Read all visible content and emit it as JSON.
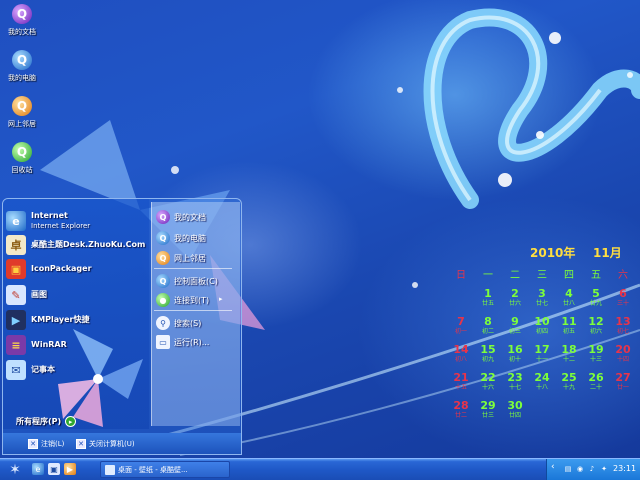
{
  "desktop": {
    "icons": [
      {
        "label": "我的文档",
        "glyph": "Q",
        "color": "#7a2fd0"
      },
      {
        "label": "我的电脑",
        "glyph": "Q",
        "color": "#1c68c8"
      },
      {
        "label": "网上邻居",
        "glyph": "Q",
        "color": "#e07a10"
      },
      {
        "label": "回收站",
        "glyph": "Q",
        "color": "#22a32a"
      }
    ]
  },
  "start_menu": {
    "pinned": [
      {
        "title": "Internet",
        "subtitle": "Internet Explorer",
        "icon": "internet-explorer-icon",
        "glyph": "e"
      },
      {
        "title": "桌酷主题Desk.ZhuoKu.Com",
        "icon": "theme-icon",
        "glyph": "卓"
      },
      {
        "title": "IconPackager",
        "icon": "iconpackager-icon",
        "glyph": "▣"
      },
      {
        "title": "画图",
        "icon": "paint-icon",
        "glyph": "✎"
      },
      {
        "title": "KMPlayer快捷",
        "icon": "kmplayer-icon",
        "glyph": "▶"
      },
      {
        "title": "WinRAR",
        "icon": "winrar-icon",
        "glyph": "≡"
      },
      {
        "title": "记事本",
        "icon": "notepad-icon",
        "glyph": "✉"
      }
    ],
    "all_programs": "所有程序(P)",
    "all_programs_arrow": "▸",
    "right_items": [
      {
        "label": "我的文档",
        "icon": "my-documents-icon",
        "glyph": "Q"
      },
      {
        "label": "我的电脑",
        "icon": "my-computer-icon",
        "glyph": "Q"
      },
      {
        "label": "网上邻居",
        "icon": "network-icon",
        "glyph": "Q"
      },
      {
        "label": "控制面板(C)",
        "icon": "control-panel-icon",
        "glyph": "Q"
      },
      {
        "label": "连接到(T)",
        "icon": "connect-icon",
        "glyph": "●",
        "arrow": "▸"
      },
      {
        "label": "搜索(S)",
        "icon": "search-icon",
        "glyph": "⚲"
      },
      {
        "label": "运行(R)...",
        "icon": "run-icon",
        "glyph": "▭"
      }
    ],
    "logoff": "注销(L)",
    "logoff_glyph": "✕",
    "shutdown": "关闭计算机(U)",
    "shutdown_glyph": "✕"
  },
  "calendar": {
    "year": "2010年",
    "month": "11月",
    "weekdays": [
      "日",
      "一",
      "二",
      "三",
      "四",
      "五",
      "六"
    ],
    "days": [
      {
        "d": "1",
        "l": "廿五"
      },
      {
        "d": "2",
        "l": "廿六"
      },
      {
        "d": "3",
        "l": "廿七"
      },
      {
        "d": "4",
        "l": "廿八"
      },
      {
        "d": "5",
        "l": "廿九"
      },
      {
        "d": "6",
        "l": "三十"
      },
      {
        "d": "7",
        "l": "初一"
      },
      {
        "d": "8",
        "l": "初二"
      },
      {
        "d": "9",
        "l": "初三"
      },
      {
        "d": "10",
        "l": "初四"
      },
      {
        "d": "11",
        "l": "初五"
      },
      {
        "d": "12",
        "l": "初六"
      },
      {
        "d": "13",
        "l": "初七"
      },
      {
        "d": "14",
        "l": "初八"
      },
      {
        "d": "15",
        "l": "初九"
      },
      {
        "d": "16",
        "l": "初十"
      },
      {
        "d": "17",
        "l": "十一"
      },
      {
        "d": "18",
        "l": "十二"
      },
      {
        "d": "19",
        "l": "十三"
      },
      {
        "d": "20",
        "l": "十四"
      },
      {
        "d": "21",
        "l": "十五"
      },
      {
        "d": "22",
        "l": "十六"
      },
      {
        "d": "23",
        "l": "十七"
      },
      {
        "d": "24",
        "l": "十八"
      },
      {
        "d": "25",
        "l": "十九"
      },
      {
        "d": "26",
        "l": "二十"
      },
      {
        "d": "27",
        "l": "廿一"
      },
      {
        "d": "28",
        "l": "廿二"
      },
      {
        "d": "29",
        "l": "廿三"
      },
      {
        "d": "30",
        "l": "廿四"
      }
    ],
    "first_weekday": 1,
    "weekend_color": "#e8344a",
    "weekday_color": "#7dff3a"
  },
  "taskbar": {
    "start_icon": "✶",
    "quick_launch": [
      {
        "icon": "ie-quicklaunch-icon",
        "glyph": "e"
      },
      {
        "icon": "show-desktop-icon",
        "glyph": "▣"
      },
      {
        "icon": "media-quicklaunch-icon",
        "glyph": "▶"
      }
    ],
    "active_task": "桌面 - 壁纸 - 桌酷壁...",
    "tray_chevron": "‹",
    "tray_icons": [
      "▤",
      "◉",
      "♪",
      "✦"
    ],
    "clock": "23:11"
  }
}
